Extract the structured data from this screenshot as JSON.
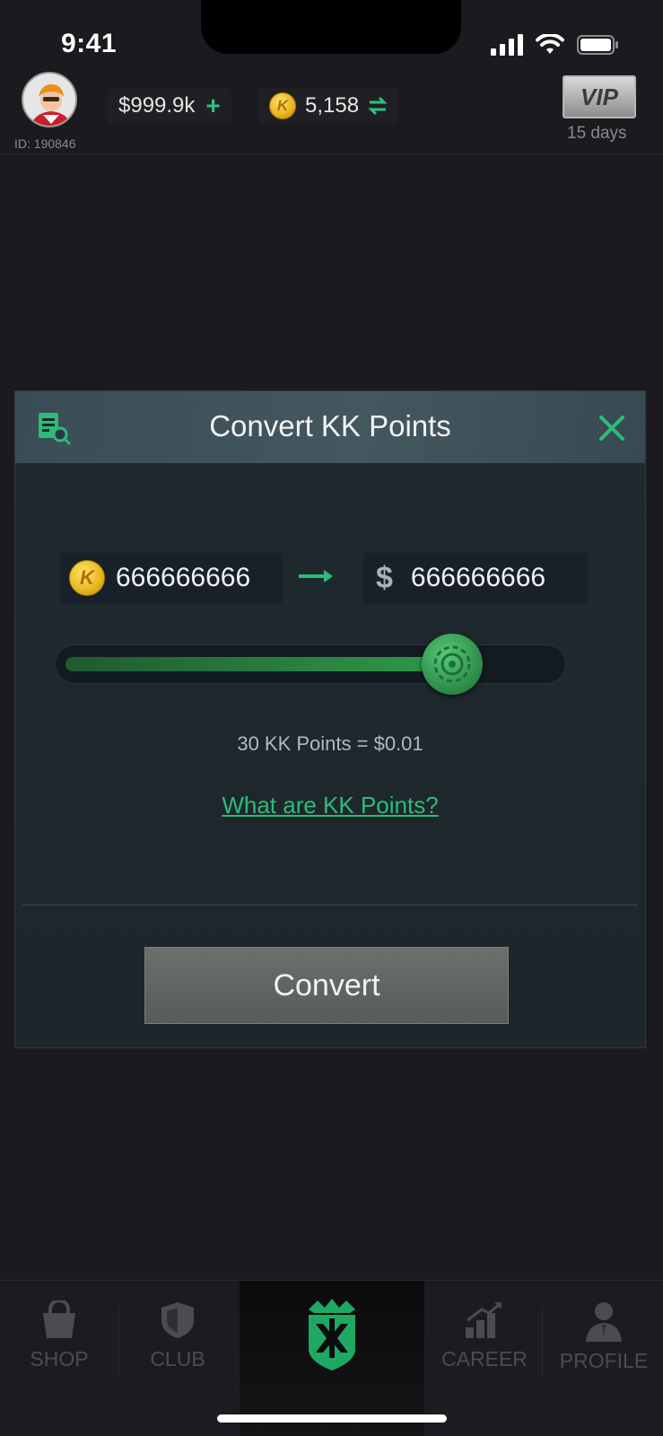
{
  "status_bar": {
    "time": "9:41"
  },
  "header": {
    "user_id": "ID: 190846",
    "cash": "$999.9k",
    "kk_points": "5,158",
    "vip_label": "VIP",
    "vip_days": "15 days",
    "coin_glyph": "K"
  },
  "modal": {
    "title": "Convert KK Points",
    "from_amount": "666666666",
    "to_amount": "666666666",
    "dollar_glyph": "$",
    "coin_glyph": "K",
    "slider_fraction": 0.79,
    "rate": "30 KK Points = $0.01",
    "help_link": "What are KK Points?",
    "convert_button": "Convert"
  },
  "tabs": [
    {
      "label": "SHOP",
      "icon": "shopping-bag-icon"
    },
    {
      "label": "CLUB",
      "icon": "shield-icon"
    },
    {
      "label": "",
      "icon": "kk-logo-icon"
    },
    {
      "label": "CAREER",
      "icon": "career-chart-icon"
    },
    {
      "label": "PROFILE",
      "icon": "person-icon"
    }
  ],
  "colors": {
    "accent": "#2bbd77",
    "background": "#1b1b1f",
    "modal": "#1f2a2f"
  }
}
